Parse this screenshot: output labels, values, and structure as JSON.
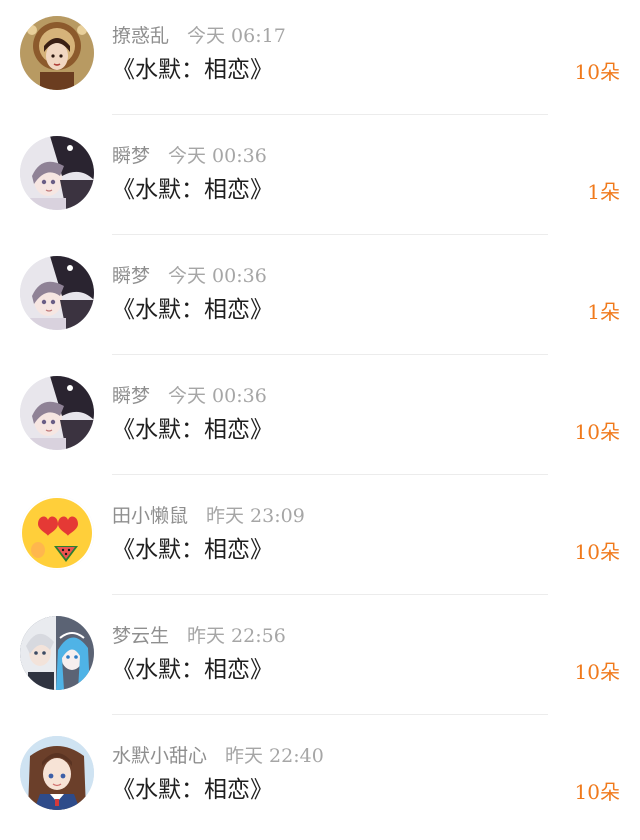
{
  "colors": {
    "accent": "#f07a1c",
    "name": "#8f8f8f",
    "title": "#1f1f1f",
    "divider": "#ececec"
  },
  "gifts": [
    {
      "user": "撩惑乱",
      "time": "今天 06:17",
      "title": "《水默：相恋》",
      "count": "10朵",
      "avatar_icon": "antique-portrait-avatar"
    },
    {
      "user": "瞬梦",
      "time": "今天 00:36",
      "title": "《水默：相恋》",
      "count": "1朵",
      "avatar_icon": "anime-couple-avatar"
    },
    {
      "user": "瞬梦",
      "time": "今天 00:36",
      "title": "《水默：相恋》",
      "count": "1朵",
      "avatar_icon": "anime-couple-avatar"
    },
    {
      "user": "瞬梦",
      "time": "今天 00:36",
      "title": "《水默：相恋》",
      "count": "10朵",
      "avatar_icon": "anime-couple-avatar"
    },
    {
      "user": "田小懒鼠",
      "time": "昨天 23:09",
      "title": "《水默：相恋》",
      "count": "10朵",
      "avatar_icon": "heart-eyes-emoji-avatar"
    },
    {
      "user": "梦云生",
      "time": "昨天 22:56",
      "title": "《水默：相恋》",
      "count": "10朵",
      "avatar_icon": "anime-pair-avatar"
    },
    {
      "user": "水默小甜心",
      "time": "昨天 22:40",
      "title": "《水默：相恋》",
      "count": "10朵",
      "avatar_icon": "anime-schoolgirl-avatar"
    }
  ]
}
